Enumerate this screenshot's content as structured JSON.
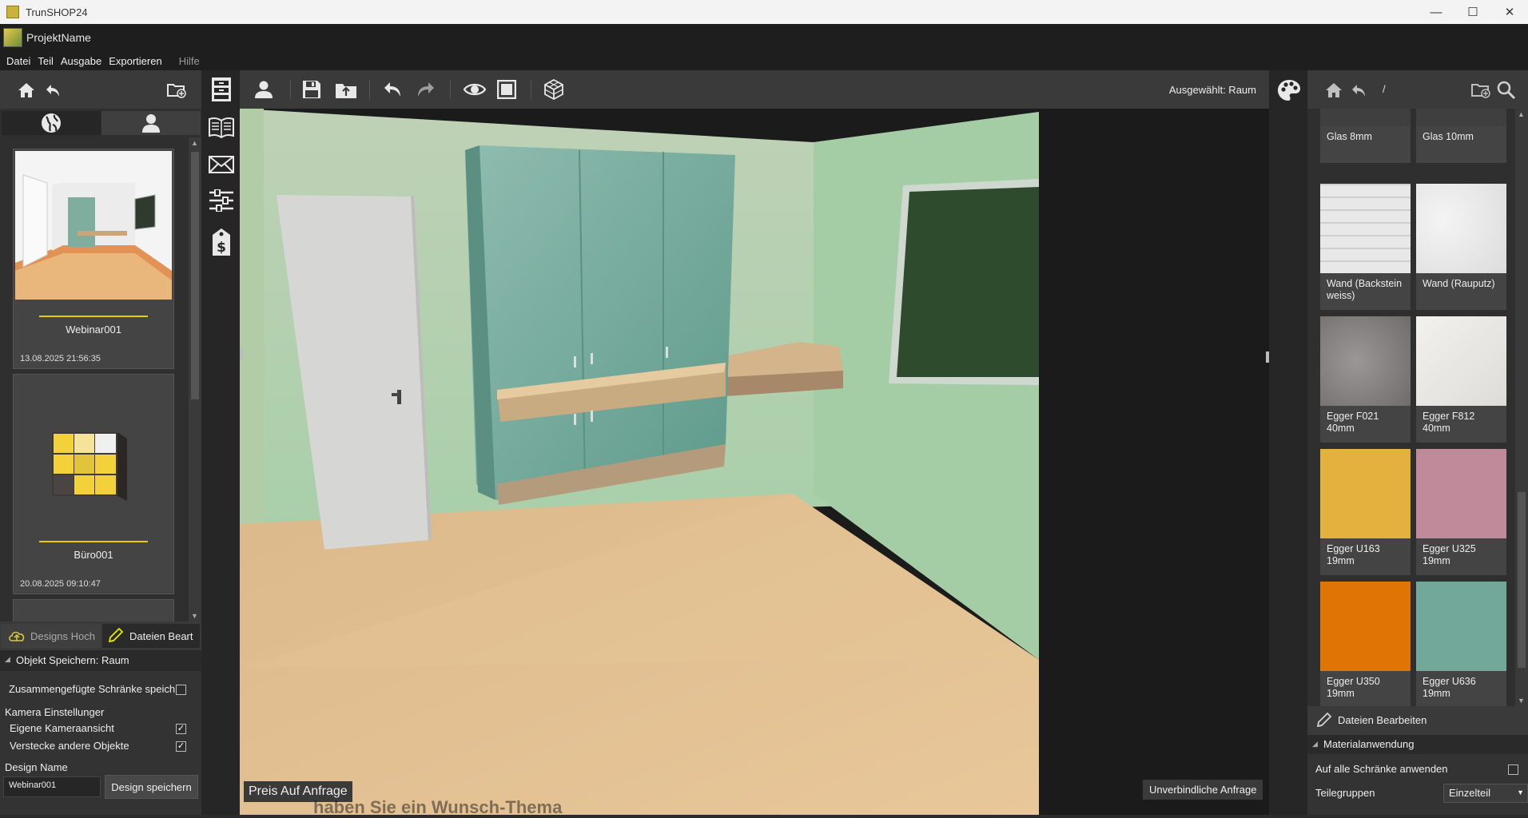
{
  "window": {
    "title": "TrunSHOP24",
    "minimize": "—",
    "maximize": "☐",
    "close": "✕"
  },
  "project": {
    "name": "ProjektName"
  },
  "menu": {
    "items": [
      "Datei",
      "Teil",
      "Ausgabe",
      "Exportieren"
    ],
    "help": "Hilfe"
  },
  "designs": [
    {
      "name": "Webinar001",
      "date": "13.08.2025 21:56:35"
    },
    {
      "name": "Büro001",
      "date": "20.08.2025 09:10:47"
    }
  ],
  "left_bottom": {
    "upload_tab": "Designs Hoch",
    "edit_tab": "Dateien Beart",
    "object_save": "Objekt Speichern: Raum",
    "combined_label": "Zusammengefügte Schränke speich",
    "combined_checked": false,
    "camera_header": "Kamera Einstellunger",
    "own_camera_label": "Eigene Kameraansicht",
    "own_camera_checked": true,
    "hide_objects_label": "Verstecke andere Objekte",
    "hide_objects_checked": true,
    "design_name_label": "Design Name",
    "design_name_value": "Webinar001",
    "save_button": "Design speichern"
  },
  "toolbar": {
    "selected": "Ausgewählt: Raum"
  },
  "viewport": {
    "price_label": "Preis Auf Anfrage",
    "inquiry_button": "Unverbindliche Anfrage"
  },
  "right": {
    "path": "/"
  },
  "materials": [
    {
      "label": "Glas 8mm",
      "color": "#3f3f3f"
    },
    {
      "label": "Glas 10mm",
      "color": "#3f3f3f"
    },
    {
      "label": "Wand (Backstein weiss)",
      "color": "#e6e6e6"
    },
    {
      "label": "Wand (Rauputz)",
      "color": "#eeeeee"
    },
    {
      "label": "Egger F021 40mm",
      "color": "#8a8786"
    },
    {
      "label": "Egger F812 40mm",
      "color": "#ecebe8"
    },
    {
      "label": "Egger U163 19mm",
      "color": "#e5b13e"
    },
    {
      "label": "Egger U325 19mm",
      "color": "#c18a9a"
    },
    {
      "label": "Egger U350 19mm",
      "color": "#e07506"
    },
    {
      "label": "Egger U636 19mm",
      "color": "#71a89a"
    }
  ],
  "right_bottom": {
    "edit_files": "Dateien Bearbeiten",
    "material_usage": "Materialanwendung",
    "apply_all_label": "Auf alle Schränke anwenden",
    "apply_all_checked": false,
    "part_groups_label": "Teilegruppen",
    "part_groups_value": "Einzelteil"
  },
  "background_text": "haben Sie ein Wunsch-Thema"
}
